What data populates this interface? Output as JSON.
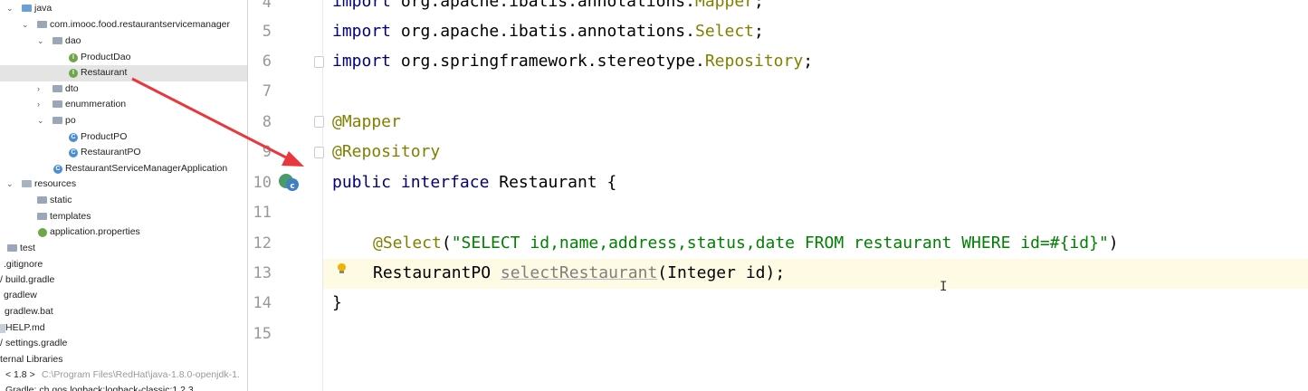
{
  "project_tree": {
    "items": [
      {
        "label": "java"
      },
      {
        "label": "com.imooc.food.restaurantservicemanager"
      },
      {
        "label": "dao"
      },
      {
        "label": "ProductDao"
      },
      {
        "label": "Restaurant"
      },
      {
        "label": "dto"
      },
      {
        "label": "enummeration"
      },
      {
        "label": "po"
      },
      {
        "label": "ProductPO"
      },
      {
        "label": "RestaurantPO"
      },
      {
        "label": "RestaurantServiceManagerApplication"
      },
      {
        "label": "resources"
      },
      {
        "label": "static"
      },
      {
        "label": "templates"
      },
      {
        "label": "application.properties"
      },
      {
        "label": "test"
      },
      {
        "label": ".gitignore"
      },
      {
        "label": "build.gradle"
      },
      {
        "label": "gradlew"
      },
      {
        "label": "gradlew.bat"
      },
      {
        "label": "HELP.md"
      },
      {
        "label": "settings.gradle"
      },
      {
        "label": "ternal Libraries"
      },
      {
        "label": "< 1.8 >",
        "path": "C:\\Program Files\\RedHat\\java-1.8.0-openjdk-1."
      },
      {
        "label": "Gradle: ch.qos.logback:logback-classic:1.2.3"
      }
    ]
  },
  "editor": {
    "line_numbers": [
      "4",
      "5",
      "6",
      "7",
      "8",
      "9",
      "10",
      "11",
      "12",
      "13",
      "14",
      "15"
    ],
    "lines": {
      "l4": {
        "kw": "import",
        "pkg": " org.apache.ibatis.annotations.",
        "cls": "Mapper",
        "end": ";"
      },
      "l5": {
        "kw": "import",
        "pkg": " org.apache.ibatis.annotations.",
        "cls": "Select",
        "end": ";"
      },
      "l6": {
        "kw": "import",
        "pkg": " org.springframework.stereotype.",
        "cls": "Repository",
        "end": ";"
      },
      "l8": {
        "ann": "@Mapper"
      },
      "l9": {
        "ann": "@Repository"
      },
      "l10": {
        "kw1": "public",
        "kw2": "interface",
        "name": " Restaurant ",
        "brace": "{"
      },
      "l12": {
        "ann": "@Select",
        "open": "(",
        "str": "\"SELECT id,name,address,status,date FROM restaurant WHERE id=#{id}\"",
        "close": ")"
      },
      "l13": {
        "type": "RestaurantPO ",
        "method": "selectRestaurant",
        "args": "(Integer id);"
      },
      "l14": {
        "brace": "}"
      }
    }
  },
  "colors": {
    "keyword": "#000080",
    "annotation": "#808000",
    "string": "#008000",
    "arrow": "#e8383d",
    "current_line": "#fffae3"
  },
  "icons": [
    "folder-icon",
    "interface-icon",
    "class-icon",
    "spring-bean-icon",
    "lightbulb-icon",
    "text-cursor-icon"
  ]
}
